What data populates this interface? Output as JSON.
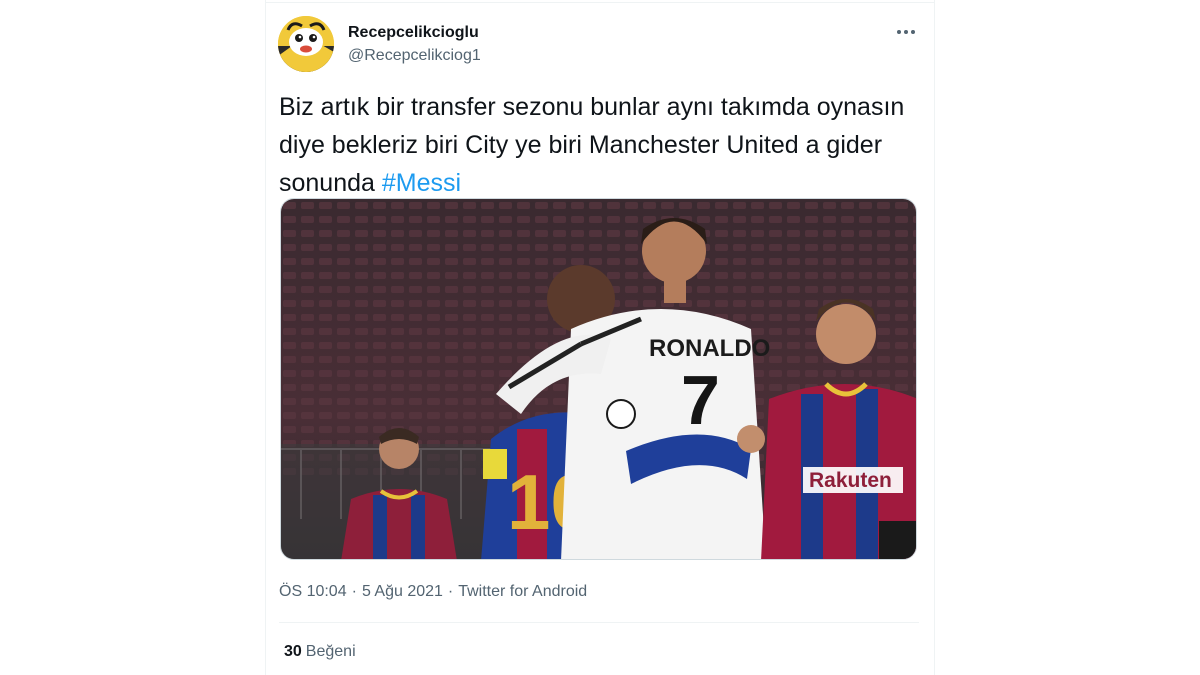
{
  "user": {
    "display_name": "Recepcelikcioglu",
    "handle": "@Recepcelikciog1"
  },
  "tweet": {
    "text_lines": [
      "Biz artık bir transfer sezonu bunlar aynı takımda oynasın",
      "diye bekleriz biri City ye biri Manchester United a gider",
      "sonunda "
    ],
    "hashtag": "#Messi"
  },
  "media": {
    "jersey_back_name": "RONALDO",
    "jersey_back_number": "7",
    "other_number": "10",
    "sponsor": "Rakuten"
  },
  "meta": {
    "time": "ÖS 10:04",
    "date": "5 Ağu 2021",
    "source": "Twitter for Android",
    "separator": "·"
  },
  "stats": {
    "likes_count": "30",
    "likes_label": "Beğeni"
  },
  "colors": {
    "link": "#1d9bf0",
    "secondary_text": "#536471",
    "primary_text": "#0f1419"
  }
}
